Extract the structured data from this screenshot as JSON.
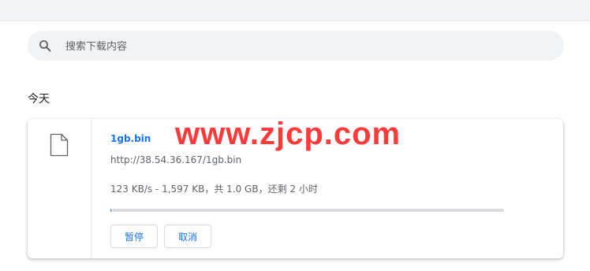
{
  "search": {
    "placeholder": "搜索下载内容"
  },
  "section": {
    "date_label": "今天"
  },
  "download": {
    "filename": "1gb.bin",
    "url": "http://38.54.36.167/1gb.bin",
    "status": "123 KB/s - 1,597 KB，共 1.0 GB，还剩 2 小时",
    "progress_fraction": 0.0016,
    "pause_label": "暂停",
    "cancel_label": "取消"
  },
  "watermark": "www.zjcp.com",
  "colors": {
    "accent": "#1a73e8",
    "watermark": "#ff2a2a"
  }
}
